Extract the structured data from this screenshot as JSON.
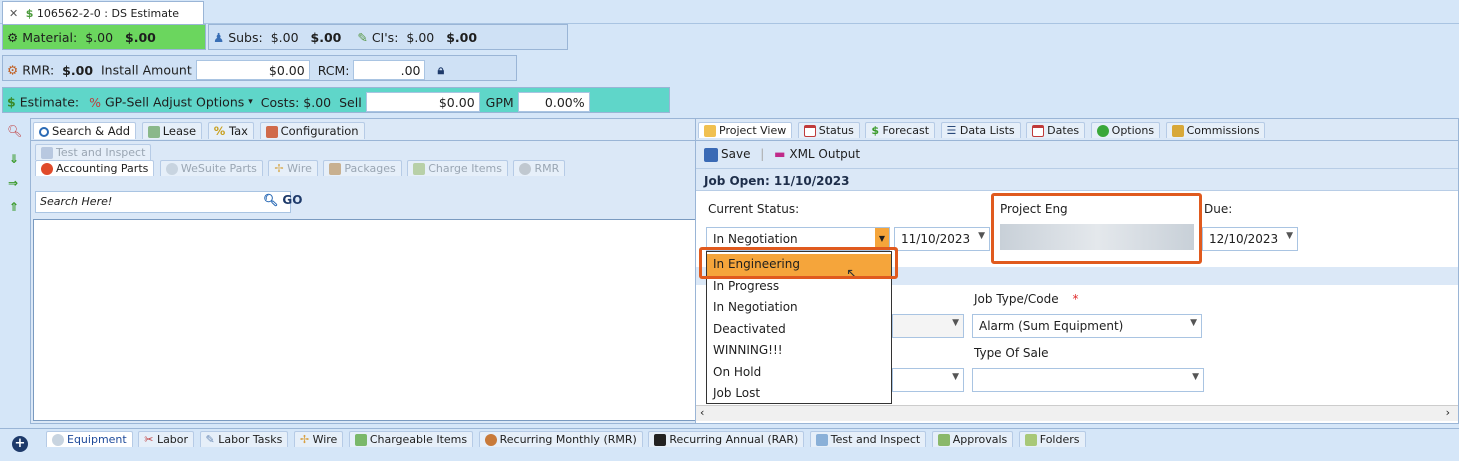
{
  "doc_tab": {
    "title": "106562-2-0 : DS Estimate"
  },
  "toolbar1": {
    "material_label": "Material:",
    "material_value1": "$.00",
    "material_value2": "$.00",
    "subs_label": "Subs:",
    "subs_value1": "$.00",
    "subs_value2": "$.00",
    "cis_label": "CI's:",
    "cis_value1": "$.00",
    "cis_value2": "$.00"
  },
  "toolbar2": {
    "rmr_label": "RMR:",
    "rmr_value": "$.00",
    "install_label": "Install Amount",
    "install_value": "$0.00",
    "rcm_label": "RCM:",
    "rcm_value": ".00"
  },
  "toolbar3": {
    "estimate_label": "Estimate:",
    "gp_sell_label": "GP-Sell Adjust Options",
    "costs_label": "Costs: $.00",
    "sell_label": "Sell",
    "sell_value": "$0.00",
    "gpm_label": "GPM",
    "gpm_value": "0.00%"
  },
  "left_panel": {
    "tabs": [
      "Search & Add",
      "Lease",
      "Tax",
      "Configuration"
    ],
    "subtab_row1": [
      "Test and Inspect"
    ],
    "subtab_row2": [
      "Accounting Parts",
      "WeSuite Parts",
      "Wire",
      "Packages",
      "Charge Items",
      "RMR"
    ],
    "search_placeholder": "Search Here!",
    "go_label": "GO"
  },
  "right_panel": {
    "tabs": [
      "Project View",
      "Status",
      "Forecast",
      "Data Lists",
      "Dates",
      "Options",
      "Commissions"
    ],
    "save_label": "Save",
    "xml_label": "XML Output",
    "job_open": "Job Open: 11/10/2023",
    "current_status_label": "Current Status:",
    "current_status_value": "In Negotiation",
    "date1": "11/10/2023",
    "project_eng_label": "Project Eng",
    "due_label": "Due:",
    "due_value": "12/10/2023",
    "job_type_label": "Job Type/Code",
    "required_mark": "*",
    "job_type_value": "Alarm (Sum Equipment)",
    "type_of_sale_label": "Type Of Sale",
    "status_options": [
      "In Engineering",
      "In Progress",
      "In Negotiation",
      "Deactivated",
      "WINNING!!!",
      "On Hold",
      "Job Lost"
    ]
  },
  "bottom_tabs": [
    "Equipment",
    "Labor",
    "Labor Tasks",
    "Wire",
    "Chargeable Items",
    "Recurring Monthly (RMR)",
    "Recurring Annual (RAR)",
    "Test and Inspect",
    "Approvals",
    "Folders"
  ],
  "colors": {
    "accent": "#e05a1e",
    "material_bg": "#6bd65e",
    "estimate_bg": "#5fd6c9",
    "selected_item": "#f5a53b"
  }
}
